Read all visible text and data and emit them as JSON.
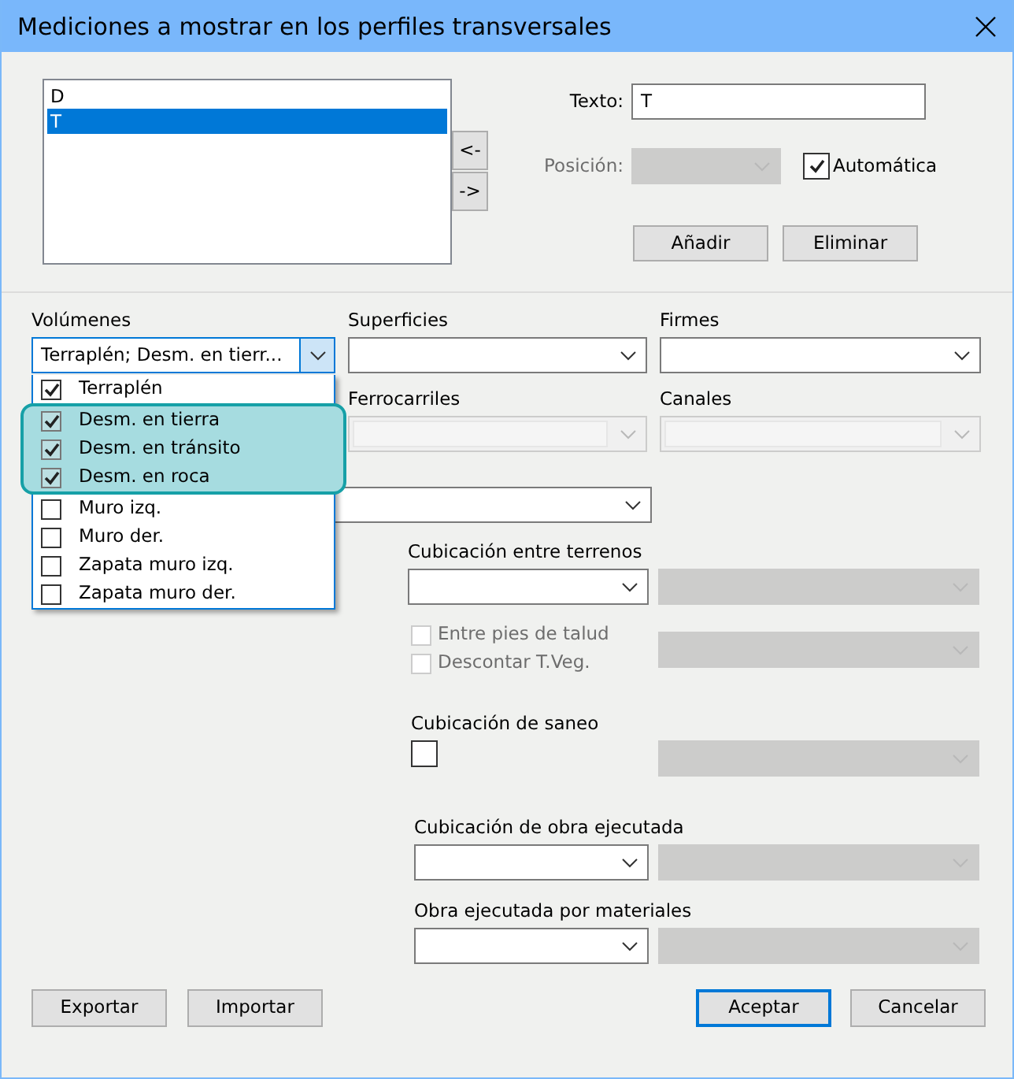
{
  "window": {
    "title": "Mediciones a mostrar en los perfiles transversales"
  },
  "marker_list": [
    {
      "text": "D",
      "selected": false
    },
    {
      "text": "T",
      "selected": true
    }
  ],
  "move_buttons": [
    "<-",
    "->"
  ],
  "texto": {
    "label": "Texto:",
    "value": "T"
  },
  "posicion": {
    "label": "Posición:",
    "disabled": true
  },
  "automatica": {
    "label": "Automática",
    "checked": true
  },
  "edit_buttons": [
    "Añadir",
    "Eliminar"
  ],
  "volumenes": {
    "label": "Volúmenes",
    "value": "Terraplén; Desm. en tierr...",
    "expanded": true,
    "options": [
      {
        "text": "Terraplén",
        "checked": true,
        "highlighted": false
      },
      {
        "text": "Desm. en tierra",
        "checked": true,
        "highlighted": true
      },
      {
        "text": "Desm. en tránsito",
        "checked": true,
        "highlighted": true
      },
      {
        "text": "Desm. en roca",
        "checked": true,
        "highlighted": true
      },
      {
        "text": "Muro izq.",
        "checked": false,
        "highlighted": false
      },
      {
        "text": "Muro der.",
        "checked": false,
        "highlighted": false
      },
      {
        "text": "Zapata muro izq.",
        "checked": false,
        "highlighted": false
      },
      {
        "text": "Zapata muro der.",
        "checked": false,
        "highlighted": false
      }
    ]
  },
  "superficies": {
    "label": "Superficies",
    "disabled": false
  },
  "firmes": {
    "label": "Firmes",
    "disabled": false
  },
  "ferrocarriles": {
    "label": "Ferrocarriles",
    "disabled": true
  },
  "canales": {
    "label": "Canales",
    "disabled": true
  },
  "combo_6": {
    "disabled": false
  },
  "cubicacion_terrenos": {
    "label": "Cubicación entre terrenos",
    "combo_disabled": false,
    "side_combo_disabled": true,
    "options": [
      {
        "label": "Entre pies de talud",
        "checked": false,
        "disabled": true
      },
      {
        "label": "Descontar T.Veg.",
        "checked": false,
        "disabled": true
      }
    ],
    "options_combo_disabled": true
  },
  "cubicacion_saneo": {
    "label": "Cubicación de saneo",
    "checked": false,
    "side_combo_disabled": true
  },
  "cubicacion_obra": {
    "label": "Cubicación de obra ejecutada",
    "combo_disabled": false,
    "side_combo_disabled": true
  },
  "obra_materiales": {
    "label": "Obra ejecutada por materiales",
    "combo_disabled": false,
    "side_combo_disabled": true
  },
  "footer_left": [
    "Exportar",
    "Importar"
  ],
  "footer_right": [
    {
      "label": "Aceptar",
      "default": true
    },
    {
      "label": "Cancelar",
      "default": false
    }
  ]
}
